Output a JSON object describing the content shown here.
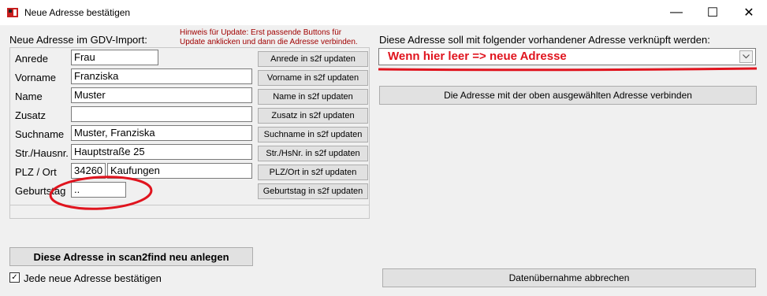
{
  "window": {
    "title": "Neue Adresse bestätigen",
    "minimize_glyph": "—",
    "maximize_glyph": "☐",
    "close_glyph": "✕"
  },
  "left": {
    "section_label": "Neue Adresse im GDV-Import:",
    "hint_line1": "Hinweis für Update: Erst passende Buttons für",
    "hint_line2": "Update anklicken und dann die Adresse verbinden.",
    "fields": {
      "anrede": {
        "label": "Anrede",
        "value": "Frau",
        "button": "Anrede in s2f updaten"
      },
      "vorname": {
        "label": "Vorname",
        "value": "Franziska",
        "button": "Vorname in s2f updaten"
      },
      "name": {
        "label": "Name",
        "value": "Muster",
        "button": "Name in s2f updaten"
      },
      "zusatz": {
        "label": "Zusatz",
        "value": "",
        "button": "Zusatz in s2f updaten"
      },
      "suchname": {
        "label": "Suchname",
        "value": "Muster, Franziska",
        "button": "Suchname in s2f updaten"
      },
      "strasse": {
        "label": "Str./Hausnr.",
        "value": "Hauptstraße 25",
        "button": "Str./HsNr. in s2f updaten"
      },
      "plz_ort": {
        "label": "PLZ / Ort",
        "plz": "34260",
        "ort": "Kaufungen",
        "button": "PLZ/Ort in s2f updaten"
      },
      "geburtstag": {
        "label": "Geburtstag",
        "value": "..",
        "button": "Geburtstag in s2f updaten"
      }
    },
    "create_button": "Diese Adresse in scan2find neu anlegen",
    "confirm_all_checkbox": {
      "label": "Jede neue Adresse bestätigen",
      "checked": true
    }
  },
  "right": {
    "link_label": "Diese Adresse soll mit folgender vorhandener Adresse verknüpft werden:",
    "dropdown_value": "Wenn hier leer => neue Adresse",
    "connect_button": "Die Adresse mit der oben ausgewählten Adresse verbinden",
    "cancel_button": "Datenübernahme abbrechen"
  },
  "colors": {
    "annotation_red": "#e0141e",
    "dropdown_text": "#e0141e",
    "hint_text": "#a00000"
  }
}
